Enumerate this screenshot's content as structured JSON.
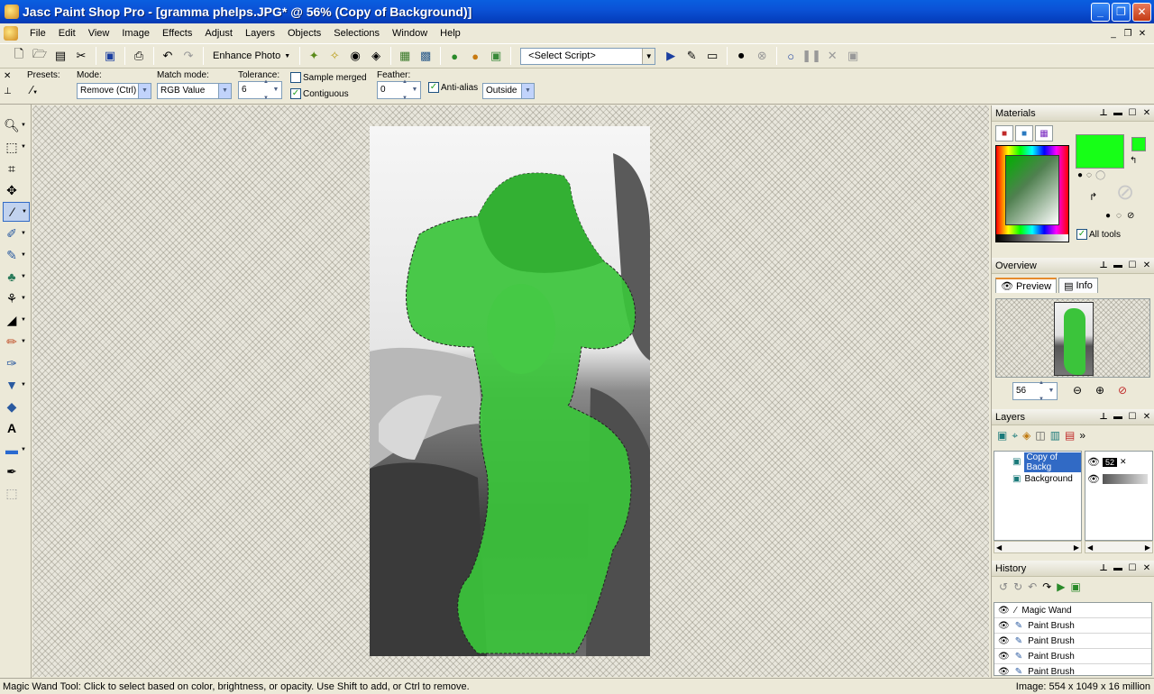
{
  "window": {
    "title": "Jasc Paint Shop Pro - [gramma phelps.JPG* @  56% (Copy of Background)]",
    "buttons": {
      "minimize": "_",
      "maximize": "❐",
      "close": "✕"
    }
  },
  "menu": [
    "File",
    "Edit",
    "View",
    "Image",
    "Effects",
    "Adjust",
    "Layers",
    "Objects",
    "Selections",
    "Window",
    "Help"
  ],
  "toolbar": {
    "enhance_photo": "Enhance Photo",
    "script_select": "<Select Script>"
  },
  "tool_options": {
    "presets_label": "Presets:",
    "mode_label": "Mode:",
    "mode_value": "Remove (Ctrl)",
    "match_mode_label": "Match mode:",
    "match_mode_value": "RGB Value",
    "tolerance_label": "Tolerance:",
    "tolerance_value": "6",
    "sample_merged": {
      "label": "Sample merged",
      "checked": false
    },
    "contiguous": {
      "label": "Contiguous",
      "checked": true
    },
    "feather_label": "Feather:",
    "feather_value": "0",
    "anti_alias": {
      "label": "Anti-alias",
      "checked": true
    },
    "anti_alias_mode": "Outside"
  },
  "materials": {
    "title": "Materials",
    "foreground_color": "#17ff17",
    "all_tools": {
      "label": "All tools",
      "checked": true
    }
  },
  "overview": {
    "title": "Overview",
    "tabs": [
      "Preview",
      "Info"
    ],
    "zoom": "56"
  },
  "layers": {
    "title": "Layers",
    "items": [
      {
        "name": "Copy of Backg",
        "opacity": "52",
        "selected": true
      },
      {
        "name": "Background",
        "selected": false
      }
    ]
  },
  "history": {
    "title": "History",
    "items": [
      "Magic Wand",
      "Paint Brush",
      "Paint Brush",
      "Paint Brush",
      "Paint Brush"
    ]
  },
  "status": {
    "hint": "Magic Wand Tool: Click to select based on color, brightness, or opacity. Use Shift to add, or Ctrl to remove.",
    "image_info": "Image:  554 x 1049 x 16 million"
  },
  "colors": {
    "selection_fill": "#3bc43b",
    "title_bar": "#0b52d6"
  }
}
